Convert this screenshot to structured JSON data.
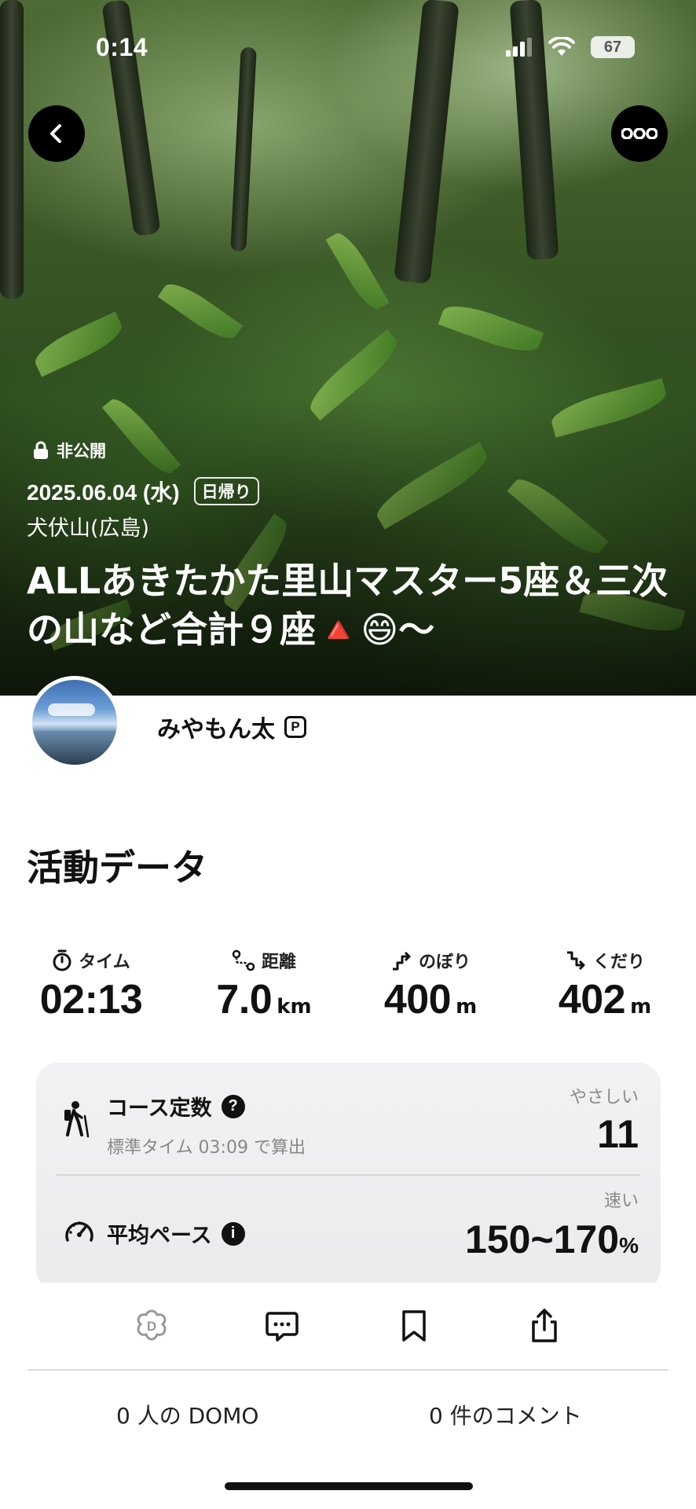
{
  "status_bar": {
    "time": "0:14",
    "battery": "67",
    "icons": [
      "signal-icon",
      "wifi-icon",
      "battery-icon"
    ]
  },
  "header": {
    "back_icon": "chevron-left-icon",
    "more_icon": "ellipsis-icon"
  },
  "hero": {
    "privacy_label": "非公開",
    "date": "2025.06.04 (水)",
    "trip_type": "日帰り",
    "mountain": "犬伏山(広島)",
    "title": "ALLあきたかた里山マスター5座＆三次の山など合計９座🔺😄〜"
  },
  "profile": {
    "username": "みやもん太",
    "badge": "P"
  },
  "activity": {
    "section_title": "活動データ",
    "stats": [
      {
        "label": "タイム",
        "value": "02:13",
        "unit": "",
        "icon": "timer-icon"
      },
      {
        "label": "距離",
        "value": "7.0",
        "unit": "km",
        "icon": "route-icon"
      },
      {
        "label": "のぼり",
        "value": "400",
        "unit": "m",
        "icon": "ascent-icon"
      },
      {
        "label": "くだり",
        "value": "402",
        "unit": "m",
        "icon": "descent-icon"
      }
    ],
    "course": {
      "title": "コース定数",
      "subtitle": "標準タイム 03:09 で算出",
      "rating": "やさしい",
      "value": "11"
    },
    "pace": {
      "title": "平均ペース",
      "rating": "速い",
      "value": "150~170",
      "unit": "%"
    }
  },
  "actions": {
    "icons": [
      "domo-icon",
      "comment-icon",
      "bookmark-icon",
      "share-icon"
    ]
  },
  "counts": {
    "domo": "0 人の DOMO",
    "comments": "0 件のコメント"
  },
  "colors": {
    "text": "#111111",
    "muted": "#888888",
    "card_bg": "#eeeeef"
  }
}
